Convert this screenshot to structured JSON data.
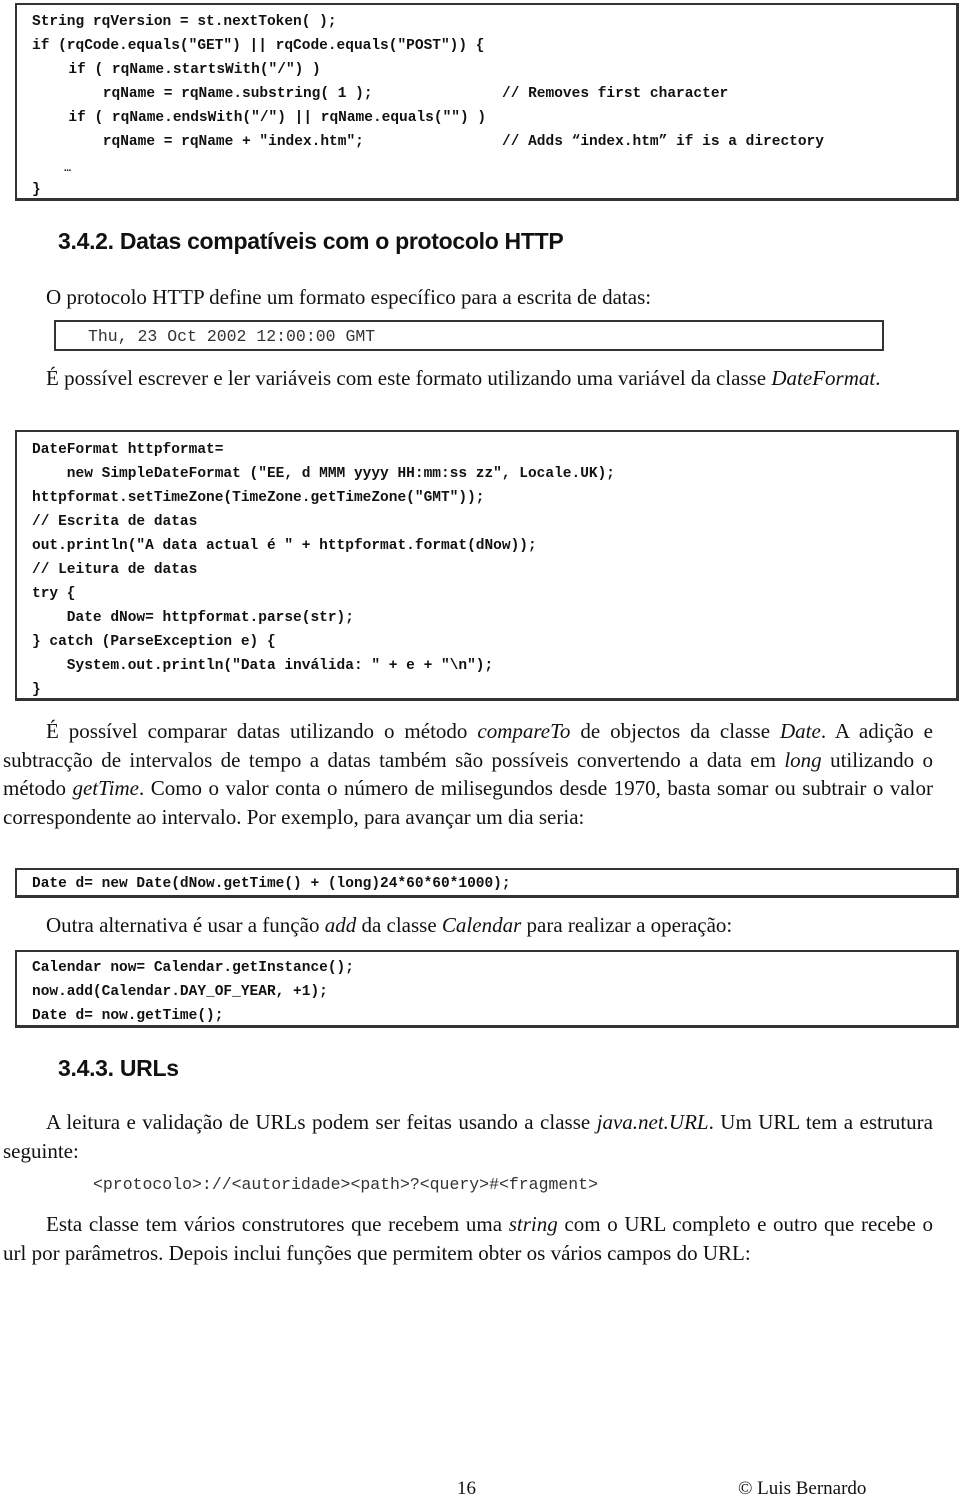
{
  "code_block_1": {
    "lines": [
      "String rqVersion = st.nextToken( );",
      "if (rqCode.equals(\"GET\") || rqCode.equals(\"POST\")) {",
      "  if ( rqName.startsWith(\"/\") )",
      "    rqName = rqName.substring( 1 );",
      "  if ( rqName.endsWith(\"/\") || rqName.equals(\"\") )",
      "    rqName = rqName + \"index.htm\";",
      "  …",
      "}"
    ],
    "comments": [
      "// Removes first character",
      "// Adds “index.htm” if is a directory"
    ]
  },
  "section_342": {
    "heading": "3.4.2. Datas compatíveis com o protocolo HTTP",
    "intro": "O protocolo HTTP define um formato específico para a escrita de datas:",
    "date_example": "Thu, 23 Oct 2002 12:00:00 GMT",
    "para_dateformat": {
      "text": "É possível escrever e ler variáveis com este formato utilizando uma variável da classe ",
      "class_name": "DateFormat",
      "end": "."
    },
    "code_block_2": {
      "lines": [
        "DateFormat httpformat=",
        "    new SimpleDateFormat (\"EE, d MMM yyyy HH:mm:ss zz\", Locale.UK);",
        "httpformat.setTimeZone(TimeZone.getTimeZone(\"GMT\"));",
        "// Escrita de datas",
        "out.println(\"A data actual é \" + httpformat.format(dNow));",
        "// Leitura de datas",
        "try {",
        "    Date dNow= httpformat.parse(str);",
        "} catch (ParseException e) {",
        "    System.out.println(\"Data inválida: \" + e + \"\\n\");",
        "}"
      ]
    },
    "para_compare": {
      "t1": "É possível comparar datas utilizando o método ",
      "i1": "compareTo",
      "t2": " de objectos da classe ",
      "i2": "Date",
      "t3": ". A adição e subtracção de intervalos de tempo a datas também são possíveis convertendo a data em ",
      "i3": "long",
      "t4": " utilizando o método ",
      "i4": "getTime",
      "t5": ". Como o valor conta o número de milisegundos desde 1970, basta somar ou subtrair o valor correspondente ao intervalo. Por exemplo, para avançar um dia seria:"
    },
    "code_block_3": {
      "lines": [
        "Date d= new Date(dNow.getTime() + (long)24*60*60*1000);"
      ]
    },
    "para_calendar": {
      "t1": "Outra alternativa é usar a função ",
      "i1": "add",
      "t2": " da classe ",
      "i2": "Calendar",
      "t3": " para realizar a operação:"
    },
    "code_block_4": {
      "lines": [
        "Calendar now= Calendar.getInstance();",
        "now.add(Calendar.DAY_OF_YEAR, +1);",
        "Date d= now.getTime();"
      ]
    }
  },
  "section_343": {
    "heading": "3.4.3. URLs",
    "para_url": {
      "t1": "A leitura e validação de URLs podem ser feitas usando a classe ",
      "i1": "java.net.URL",
      "t2": ". Um URL tem a estrutura seguinte:"
    },
    "url_structure": "<protocolo>://<autoridade><path>?<query>#<fragment>",
    "para_constructors": {
      "t1": "Esta classe tem vários construtores que recebem uma ",
      "i1": "string",
      "t2": " com o URL completo e outro que recebe o url por parâmetros. Depois inclui funções que permitem obter os vários campos do URL:"
    }
  },
  "footer": {
    "page_number": "16",
    "copyright": "© Luis Bernardo"
  }
}
